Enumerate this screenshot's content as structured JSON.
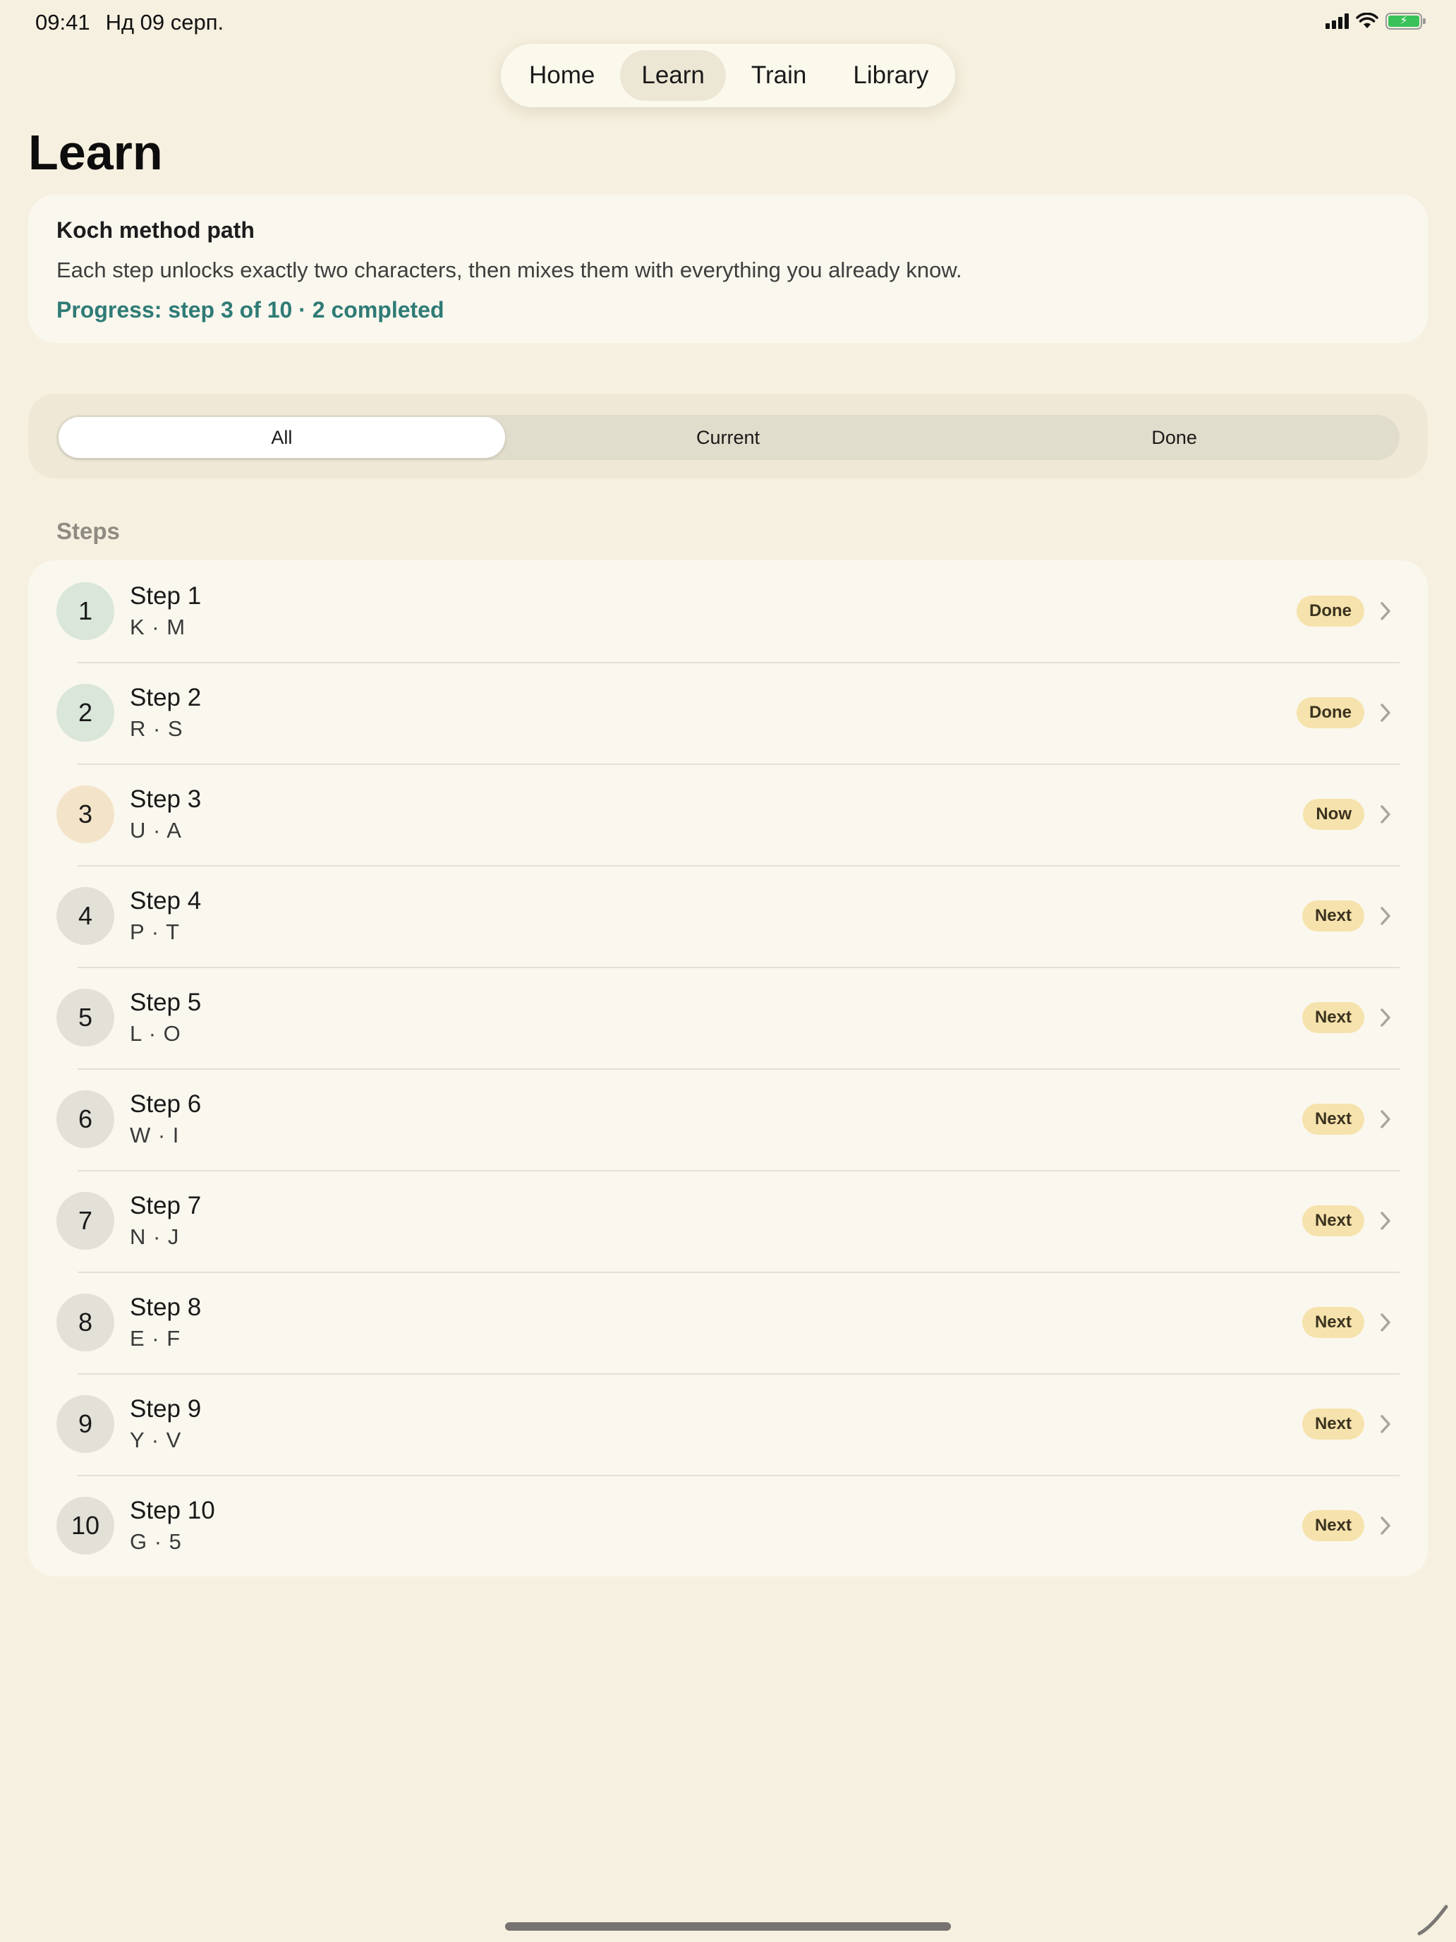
{
  "status_bar": {
    "time": "09:41",
    "date": "Нд 09 серп."
  },
  "tabs": [
    {
      "label": "Home",
      "active": false
    },
    {
      "label": "Learn",
      "active": true
    },
    {
      "label": "Train",
      "active": false
    },
    {
      "label": "Library",
      "active": false
    }
  ],
  "page": {
    "title": "Learn"
  },
  "info_card": {
    "title": "Koch method path",
    "description": "Each step unlocks exactly two characters, then mixes them with everything you already know.",
    "progress": "Progress: step 3 of 10 · 2 completed"
  },
  "filter": {
    "options": [
      "All",
      "Current",
      "Done"
    ],
    "selected": "All"
  },
  "steps_section": {
    "label": "Steps",
    "items": [
      {
        "number": "1",
        "title": "Step 1",
        "chars": "K · M",
        "badge": "Done",
        "state": "done"
      },
      {
        "number": "2",
        "title": "Step 2",
        "chars": "R · S",
        "badge": "Done",
        "state": "done"
      },
      {
        "number": "3",
        "title": "Step 3",
        "chars": "U · A",
        "badge": "Now",
        "state": "now"
      },
      {
        "number": "4",
        "title": "Step 4",
        "chars": "P · T",
        "badge": "Next",
        "state": "next"
      },
      {
        "number": "5",
        "title": "Step 5",
        "chars": "L · O",
        "badge": "Next",
        "state": "next"
      },
      {
        "number": "6",
        "title": "Step 6",
        "chars": "W · I",
        "badge": "Next",
        "state": "next"
      },
      {
        "number": "7",
        "title": "Step 7",
        "chars": "N · J",
        "badge": "Next",
        "state": "next"
      },
      {
        "number": "8",
        "title": "Step 8",
        "chars": "E · F",
        "badge": "Next",
        "state": "next"
      },
      {
        "number": "9",
        "title": "Step 9",
        "chars": "Y · V",
        "badge": "Next",
        "state": "next"
      },
      {
        "number": "10",
        "title": "Step 10",
        "chars": "G · 5",
        "badge": "Next",
        "state": "next"
      }
    ]
  },
  "colors": {
    "background": "#f6f0e0",
    "card": "#faf7ee",
    "accent_teal": "#2f7b76",
    "badge": "#f6e2ac",
    "done_circle": "#d9e6d9",
    "now_circle": "#f3e4c9",
    "next_circle": "#e2e0d7"
  },
  "icons": [
    "cellular-signal-icon",
    "wifi-icon",
    "battery-charging-icon",
    "chevron-right-icon"
  ]
}
